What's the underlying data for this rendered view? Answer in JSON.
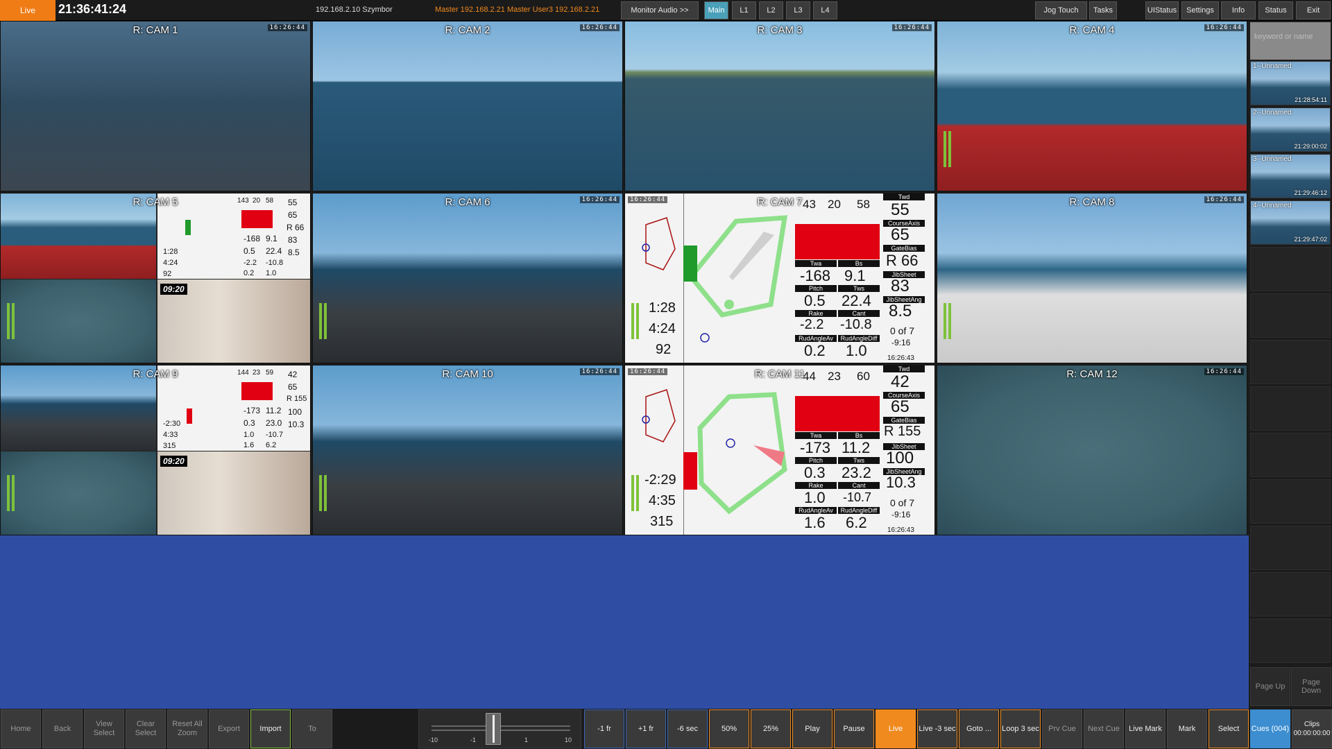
{
  "header": {
    "live_label": "Live",
    "clock": "21:36:41:24",
    "ip_info": "192.168.2.10 Szymbor",
    "master_info": "Master 192.168.2.21   Master   User3   192.168.2.21",
    "buttons": {
      "monitor_audio": "Monitor Audio >>",
      "main": "Main",
      "l1": "L1",
      "l2": "L2",
      "l3": "L3",
      "l4": "L4",
      "jog_touch": "Jog Touch",
      "tasks": "Tasks",
      "uistatus": "UIStatus",
      "settings": "Settings",
      "info": "Info",
      "status": "Status",
      "exit": "Exit"
    }
  },
  "cameras": [
    {
      "label": "R: CAM 1",
      "timestamp": "16:26:44"
    },
    {
      "label": "R: CAM 2",
      "timestamp": "16:26:44"
    },
    {
      "label": "R: CAM 3",
      "timestamp": "16:26:44"
    },
    {
      "label": "R: CAM 4",
      "timestamp": "16:26:44"
    },
    {
      "label": "R: CAM 5",
      "timestamp": ""
    },
    {
      "label": "R: CAM 6",
      "timestamp": "16:26:44"
    },
    {
      "label": "R: CAM 7",
      "timestamp": "16:26:44"
    },
    {
      "label": "R: CAM 8",
      "timestamp": "16:26:44"
    },
    {
      "label": "R: CAM 9",
      "timestamp": ""
    },
    {
      "label": "R: CAM 10",
      "timestamp": "16:26:44"
    },
    {
      "label": "R: CAM 11",
      "timestamp": "16:26:44"
    },
    {
      "label": "R: CAM 12",
      "timestamp": "16:26:44"
    }
  ],
  "telemetry_cam7": {
    "top": [
      "43",
      "20",
      "58"
    ],
    "twd_label": "Twd",
    "twd": "55",
    "courseaxis_label": "CourseAxis",
    "courseaxis": "65",
    "gatebias_label": "GateBias",
    "gatebias": "R 66",
    "twa_label": "Twa",
    "twa": "-168",
    "bs_label": "Bs",
    "bs": "9.1",
    "jibsheet_label": "JibSheet",
    "jibsheet": "83",
    "pitch_label": "Pitch",
    "pitch": "0.5",
    "tws_label": "Tws",
    "tws": "22.4",
    "jibsheetang_label": "JibSheetAng",
    "jibsheetang": "8.5",
    "rake_label": "Rake",
    "rake": "-2.2",
    "cant_label": "Cant",
    "cant": "-10.8",
    "of_label": "0 of 7",
    "rudav_label": "RudAngleAv",
    "rudav": "0.2",
    "ruddiff_label": "RudAngleDiff",
    "ruddiff": "1.0",
    "delta": "-9:16",
    "time": "16:26:43",
    "left_times": [
      "1:28",
      "4:24",
      "92"
    ]
  },
  "telemetry_cam11": {
    "top": [
      "44",
      "23",
      "60"
    ],
    "twd": "42",
    "courseaxis": "65",
    "gatebias": "R 155",
    "twa": "-173",
    "bs": "11.2",
    "jibsheet": "100",
    "pitch": "0.3",
    "tws": "23.2",
    "jibsheetang": "10.3",
    "rake": "1.0",
    "cant": "-10.7",
    "of_label": "0 of 7",
    "rudav": "1.6",
    "ruddiff": "6.2",
    "delta": "-9:16",
    "time": "16:26:43",
    "left_times": [
      "-2:29",
      "4:35",
      "315"
    ]
  },
  "mini_cam5": {
    "nums": [
      "143",
      "20",
      "58",
      "55",
      "65",
      "R 66",
      "-168",
      "9.1",
      "83",
      "0.5",
      "22.4",
      "8.5",
      "-2.2",
      "-10.8",
      "0.2",
      "1.0"
    ],
    "left": [
      "1:28",
      "4:24",
      "92"
    ],
    "clock": "09:20"
  },
  "mini_cam9": {
    "nums": [
      "144",
      "23",
      "59",
      "42",
      "65",
      "R 155",
      "-173",
      "11.2",
      "100",
      "0.3",
      "23.0",
      "10.3",
      "1.0",
      "-10.7",
      "1.6",
      "6.2"
    ],
    "left": [
      "-2:30",
      "4:33",
      "315"
    ],
    "clock": "09:20"
  },
  "sidebar": {
    "search_placeholder": "keyword or name",
    "clips": [
      {
        "name": "1--Unnamed",
        "time": "21:28:54:11"
      },
      {
        "name": "2--Unnamed",
        "time": "21:29:00:02"
      },
      {
        "name": "3--Unnamed",
        "time": "21:29:46:12"
      },
      {
        "name": "4--Unnamed",
        "time": "21:29:47:02"
      }
    ],
    "page_up": "Page Up",
    "page_down": "Page Down"
  },
  "bottom": {
    "home": "Home",
    "back": "Back",
    "view_select": "View Select",
    "clear_select": "Clear Select",
    "reset_zoom": "Reset All Zoom",
    "export": "Export",
    "import": "Import",
    "to": "To",
    "jog_ticks": [
      "-10",
      "-1",
      "1",
      "10"
    ],
    "minus_1fr": "-1 fr",
    "plus_1fr": "+1 fr",
    "minus_6sec": "-6 sec",
    "p50": "50%",
    "p25": "25%",
    "play": "Play",
    "pause": "Pause",
    "live": "Live",
    "live_minus3": "Live -3 sec",
    "goto": "Goto ...",
    "loop": "Loop 3 sec",
    "prv_cue": "Prv Cue",
    "next_cue": "Next Cue",
    "live_mark": "Live Mark",
    "mark": "Mark",
    "select": "Select",
    "cues": "Cues (004)",
    "clips": "Clips 00:00:00:00"
  },
  "colors": {
    "accent_orange": "#f08a1e",
    "main_active": "#4aa0b8",
    "blue_area": "#2f4ea3",
    "red_panel": "#e00012",
    "green_bar": "#1f9a2b"
  }
}
